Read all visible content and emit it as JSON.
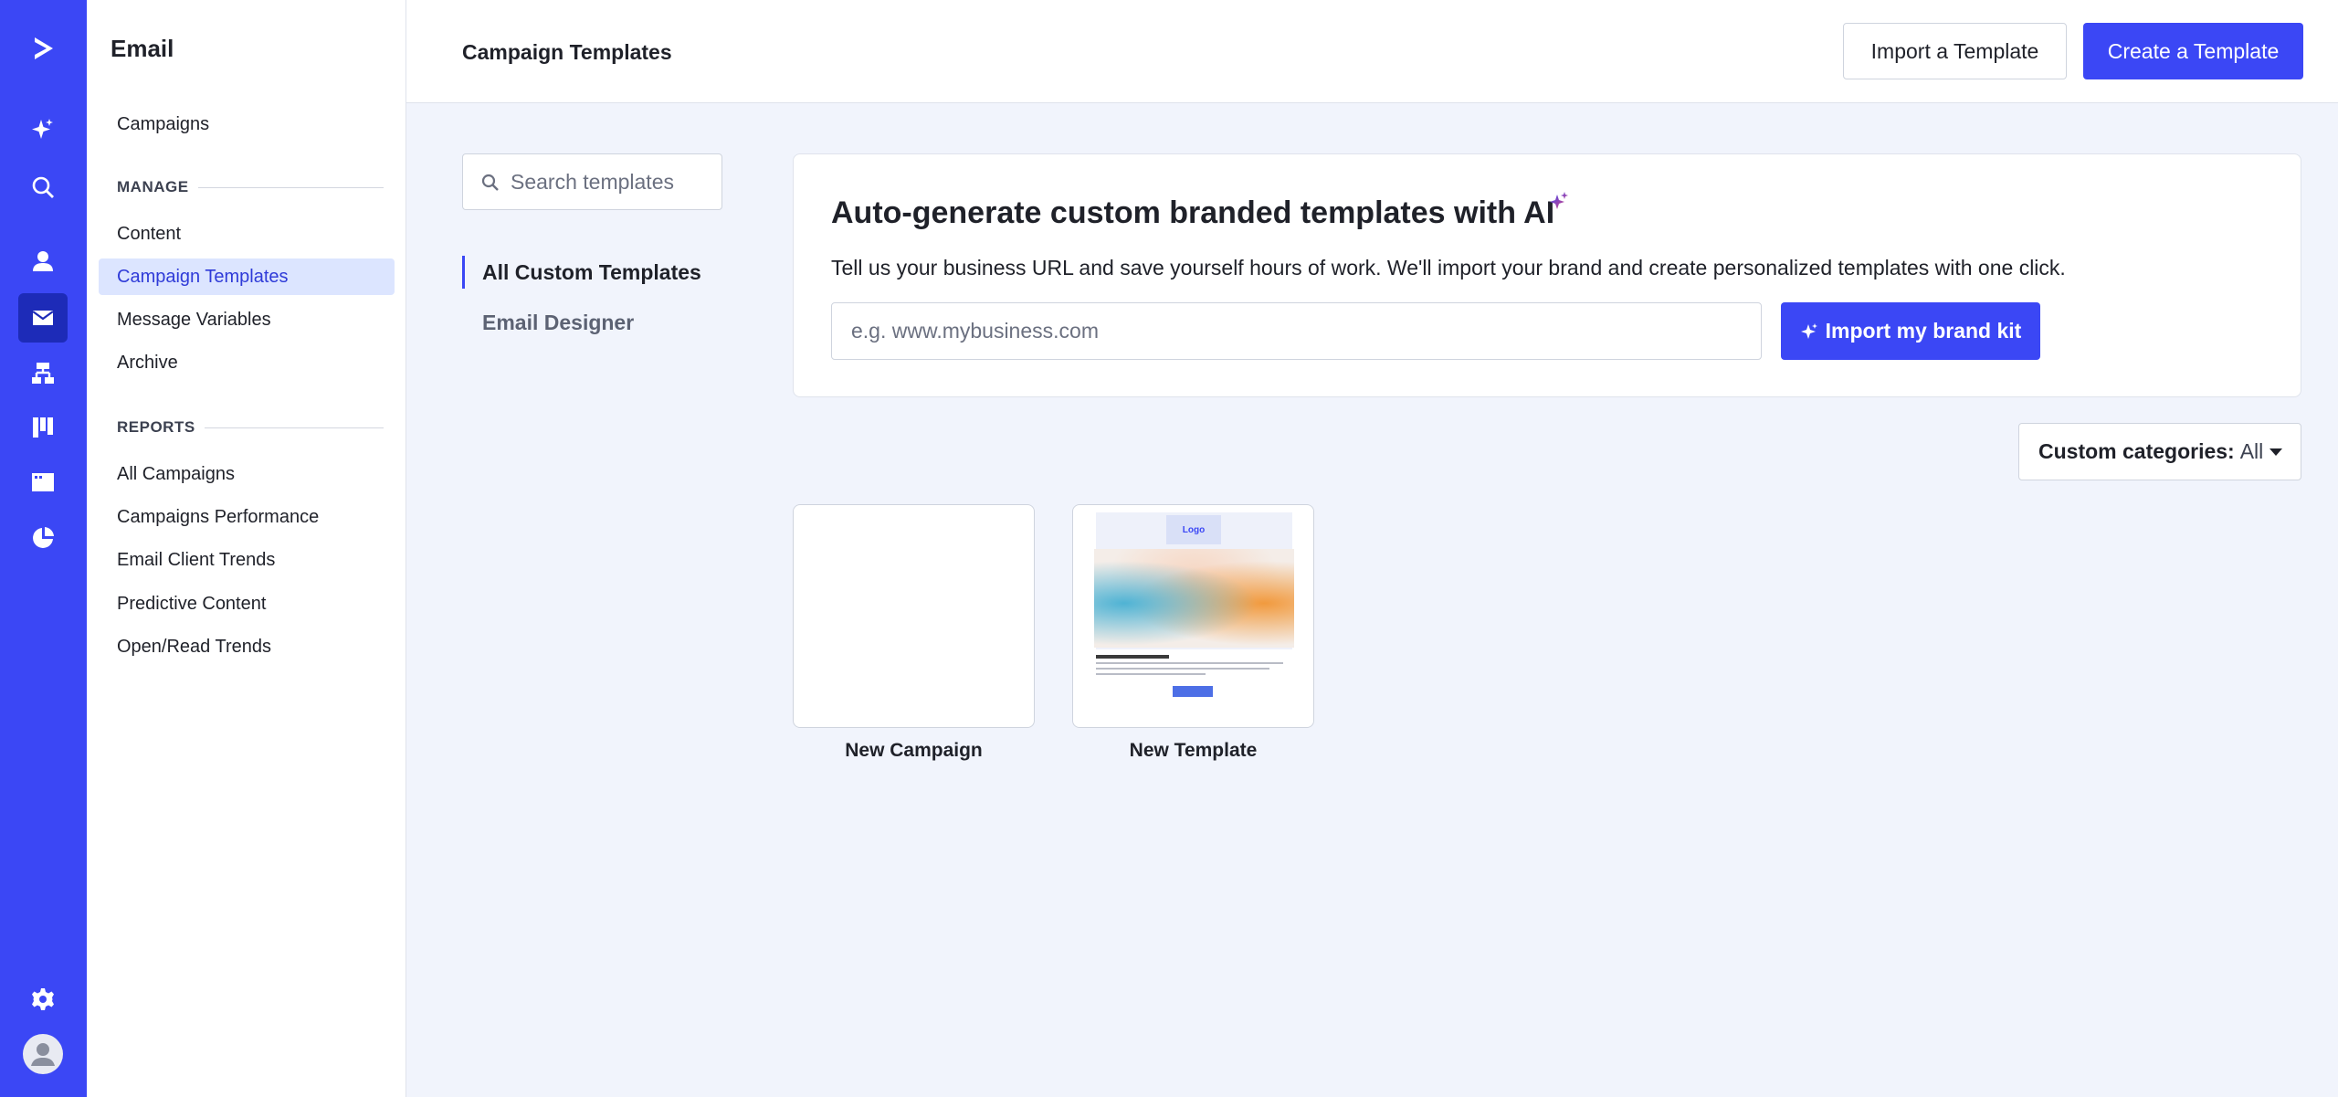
{
  "rail": {
    "icons": [
      "activecampaign-logo-icon",
      "sparkle-icon",
      "search-icon",
      "contacts-icon",
      "email-icon",
      "automations-icon",
      "pipelines-icon",
      "website-icon",
      "reports-icon",
      "settings-icon",
      "user-avatar-icon"
    ],
    "active": "email-icon"
  },
  "subnav": {
    "title": "Email",
    "top_items": [
      {
        "label": "Campaigns"
      }
    ],
    "manage": {
      "header": "MANAGE",
      "items": [
        {
          "label": "Content"
        },
        {
          "label": "Campaign Templates",
          "active": true
        },
        {
          "label": "Message Variables"
        },
        {
          "label": "Archive"
        }
      ]
    },
    "reports": {
      "header": "REPORTS",
      "items": [
        {
          "label": "All Campaigns"
        },
        {
          "label": "Campaigns Performance"
        },
        {
          "label": "Email Client Trends"
        },
        {
          "label": "Predictive Content"
        },
        {
          "label": "Open/Read Trends"
        }
      ]
    }
  },
  "header": {
    "title": "Campaign Templates",
    "import_label": "Import a Template",
    "create_label": "Create a Template"
  },
  "search": {
    "placeholder": "Search templates"
  },
  "categories": [
    {
      "label": "All Custom Templates",
      "active": true
    },
    {
      "label": "Email Designer"
    }
  ],
  "ai_card": {
    "title": "Auto-generate custom branded templates with AI",
    "description": "Tell us your business URL and save yourself hours of work. We'll import your brand and create personalized templates with one click.",
    "input_placeholder": "e.g. www.mybusiness.com",
    "button_label": "Import my brand kit"
  },
  "filter": {
    "label": "Custom categories:",
    "value": "All"
  },
  "templates": [
    {
      "name": "New Campaign"
    },
    {
      "name": "New Template",
      "thumb_logo": "Logo"
    }
  ],
  "colors": {
    "accent": "#3b47f5",
    "active_bg": "#dce5ff"
  }
}
